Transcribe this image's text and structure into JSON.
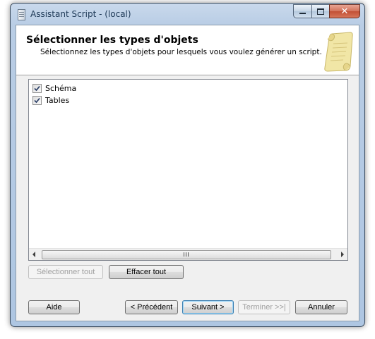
{
  "window": {
    "title": "Assistant Script - (local)",
    "close_symbol": "✕"
  },
  "header": {
    "title": "Sélectionner les types d'objets",
    "subtitle": "Sélectionnez les types d'objets pour lesquels vous voulez générer un script."
  },
  "object_types": [
    {
      "label": "Schéma",
      "checked": true
    },
    {
      "label": "Tables",
      "checked": true
    }
  ],
  "selection_buttons": {
    "select_all": "Sélectionner tout",
    "clear_all": "Effacer tout"
  },
  "footer_buttons": {
    "help": "Aide",
    "previous": "< Précédent",
    "next": "Suivant >",
    "finish": "Terminer >>|",
    "cancel": "Annuler"
  },
  "colors": {
    "title_text": "#1e3957",
    "close_button": "#c24f34",
    "default_button_border": "#3c7fb1"
  },
  "icons": [
    "app-icon",
    "minimize-icon",
    "maximize-icon",
    "close-icon",
    "scroll-document-icon",
    "checkbox-checked-icon"
  ]
}
